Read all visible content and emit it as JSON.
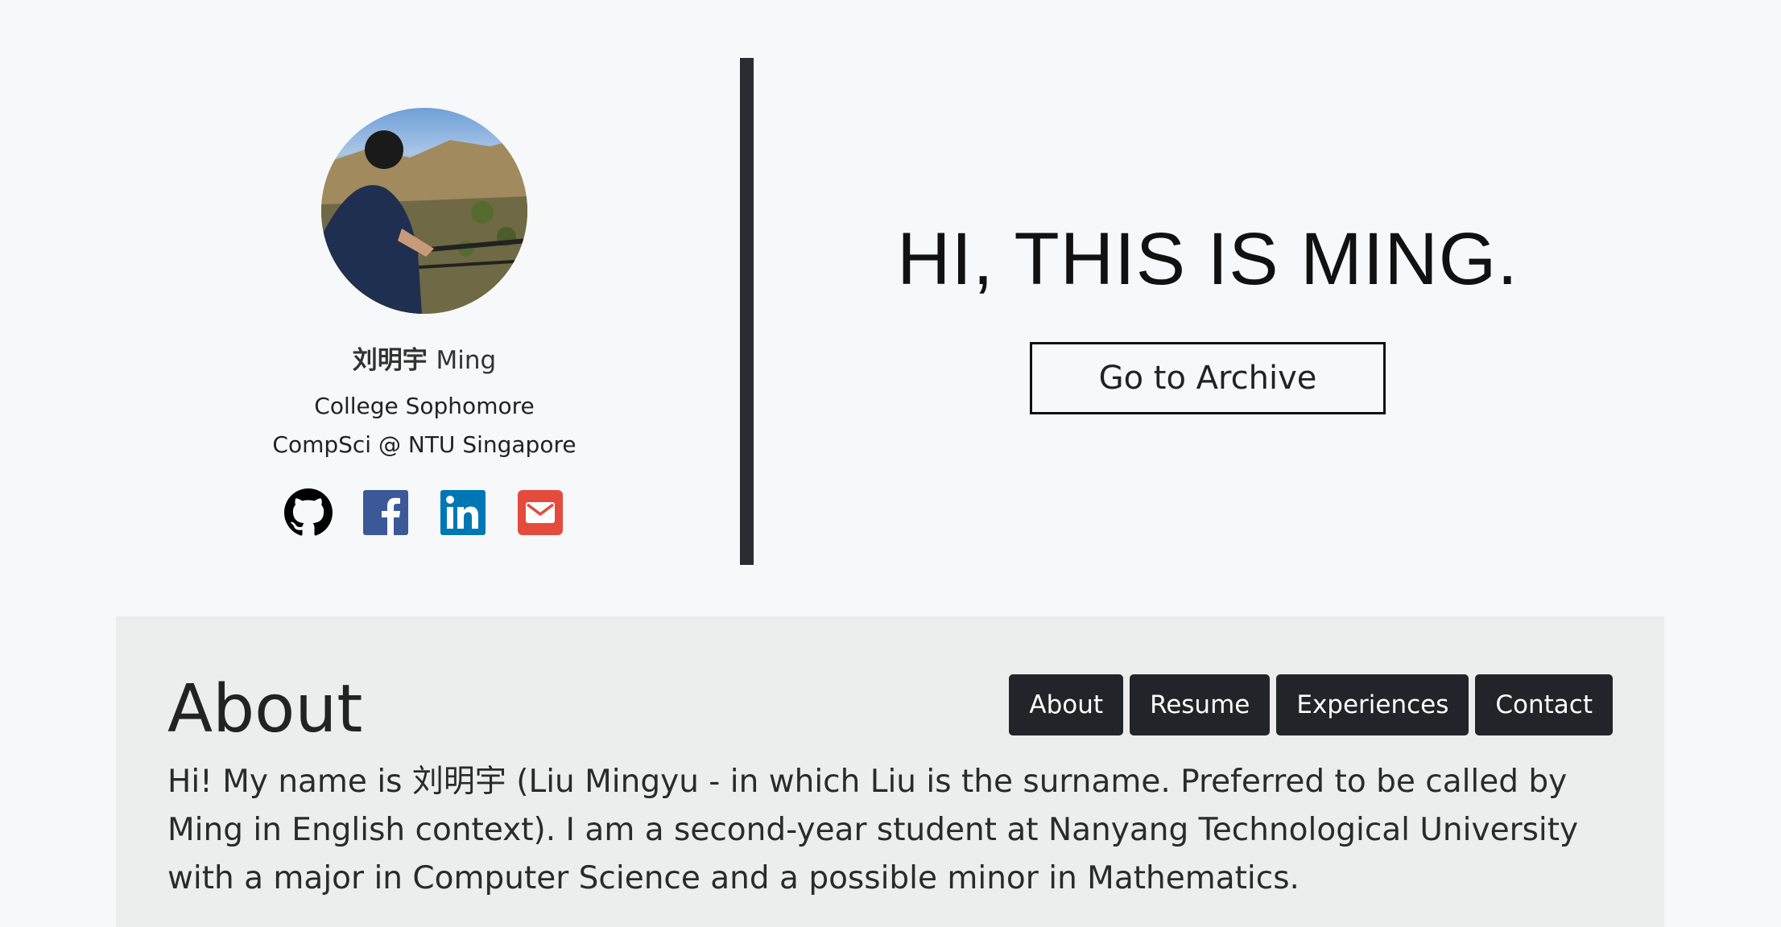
{
  "profile": {
    "name_cn": "刘明宇",
    "name_en": "Ming",
    "subtitle_1": "College Sophomore",
    "subtitle_2": "CompSci @ NTU Singapore",
    "socials": [
      {
        "icon": "github-icon",
        "color": "#000000"
      },
      {
        "icon": "facebook-icon",
        "color": "#3b5998"
      },
      {
        "icon": "linkedin-icon",
        "color": "#0077b5"
      },
      {
        "icon": "email-icon",
        "color": "#e54b3c"
      }
    ]
  },
  "hero": {
    "headline": "HI, THIS IS MING.",
    "archive_button": "Go to Archive"
  },
  "about": {
    "title": "About",
    "nav": [
      "About",
      "Resume",
      "Experiences",
      "Contact"
    ],
    "text": "Hi! My name is 刘明宇 (Liu Mingyu - in which Liu is the surname. Preferred to be called by Ming in English context). I am a second-year student at Nanyang Technological University with a major in Computer Science and a possible minor in Mathematics."
  },
  "colors": {
    "page_bg": "#f7f8f9",
    "divider": "#2b2c31",
    "about_bg": "#eceded",
    "nav_btn": "#212529"
  }
}
